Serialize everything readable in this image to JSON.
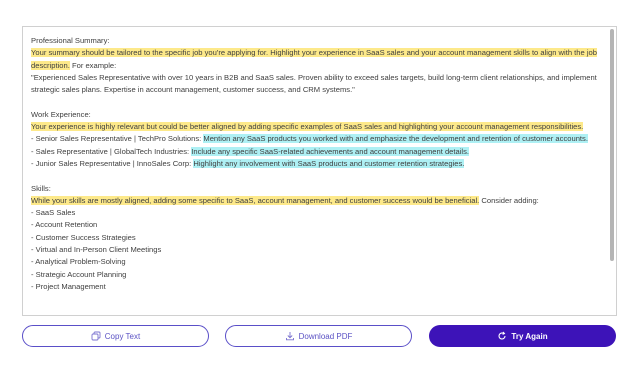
{
  "result": {
    "summary_heading": "Professional Summary:",
    "summary_feedback": "Your summary should be tailored to the specific job you're applying for. Highlight your experience in SaaS sales and your account management skills to align with the job description.",
    "summary_example_intro": " For example:",
    "summary_example": "\"Experienced Sales Representative with over 10 years in B2B and SaaS sales. Proven ability to exceed sales targets, build long-term client relationships, and implement strategic sales plans. Expertise in account management, customer success, and CRM systems.\"",
    "work_heading": "Work Experience:",
    "work_feedback": "Your experience is highly relevant but could be better aligned by adding specific examples of SaaS sales and highlighting your account management responsibilities.",
    "jobs": [
      {
        "title": "- Senior Sales Representative | TechPro Solutions: ",
        "tip": "Mention any SaaS products you worked with and emphasize the development and retention of customer accounts."
      },
      {
        "title": "- Sales Representative | GlobalTech Industries: ",
        "tip": "Include any specific SaaS-related achievements and account management details."
      },
      {
        "title": "- Junior Sales Representative | InnoSales Corp: ",
        "tip": "Highlight any involvement with SaaS products and customer retention strategies."
      }
    ],
    "skills_heading": "Skills:",
    "skills_feedback": "While your skills are mostly aligned, adding some specific to SaaS, account management, and customer success would be beneficial.",
    "skills_consider": " Consider adding:",
    "skills": [
      "- SaaS Sales",
      "- Account Retention",
      "- Customer Success Strategies",
      "- Virtual and In-Person Client Meetings",
      "- Analytical Problem-Solving",
      "- Strategic Account Planning",
      "- Project Management"
    ]
  },
  "actions": {
    "copy_label": "Copy Text",
    "copy_icon": "copy-icon",
    "pdf_label": "Download PDF",
    "pdf_icon": "download-icon",
    "try_label": "Try Again",
    "try_icon": "refresh-icon"
  },
  "colors": {
    "highlight_yellow": "#fde98a",
    "highlight_blue": "#aef0f4",
    "accent": "#3d13b8",
    "outline": "#5a4fc8"
  }
}
